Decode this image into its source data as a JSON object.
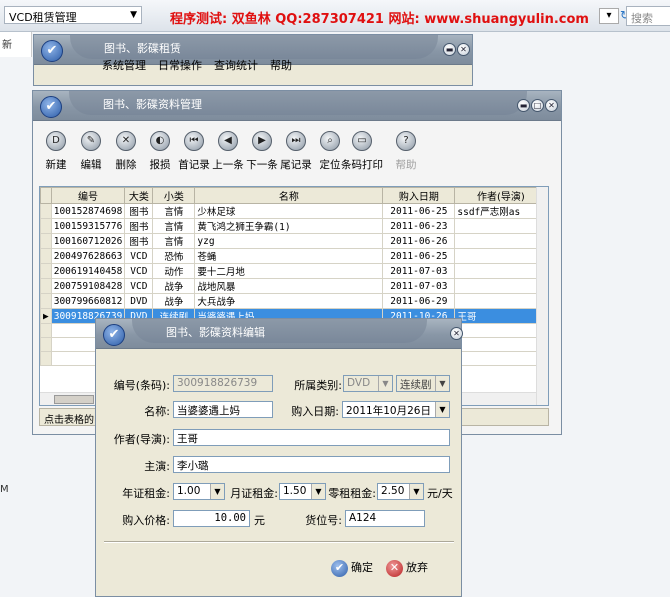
{
  "browser": {
    "tab_title": "VCD租赁管理",
    "banner": "程序测试: 双鱼林 QQ:287307421  网站: www.shuangyulin.com",
    "search_placeholder": "搜索",
    "side_tab": "新",
    "left_fragment": "M"
  },
  "rent_window": {
    "title": "图书、影碟租赁",
    "menu": [
      "系统管理",
      "日常操作",
      "查询统计",
      "帮助"
    ]
  },
  "manage_window": {
    "title": "图书、影碟资料管理",
    "toolbar": [
      {
        "label": "新建",
        "icon": "new-icon",
        "glyph": "D"
      },
      {
        "label": "编辑",
        "icon": "edit-icon",
        "glyph": "✎"
      },
      {
        "label": "删除",
        "icon": "delete-icon",
        "glyph": "✕"
      },
      {
        "label": "报损",
        "icon": "damage-icon",
        "glyph": "◐"
      },
      {
        "label": "首记录",
        "icon": "first-record-icon",
        "glyph": "⏮"
      },
      {
        "label": "上一条",
        "icon": "prev-record-icon",
        "glyph": "◀"
      },
      {
        "label": "下一条",
        "icon": "next-record-icon",
        "glyph": "▶"
      },
      {
        "label": "尾记录",
        "icon": "last-record-icon",
        "glyph": "⏭"
      },
      {
        "label": "定位",
        "icon": "locate-icon",
        "glyph": "⌕"
      },
      {
        "label": "条码打印",
        "icon": "barcode-print-icon",
        "glyph": "▭"
      },
      {
        "label": "帮助",
        "icon": "help-icon",
        "glyph": "?"
      }
    ],
    "columns": [
      "编号",
      "大类",
      "小类",
      "名称",
      "购入日期",
      "作者(导演)"
    ],
    "rows": [
      [
        "100152874698",
        "图书",
        "言情",
        "少林足球",
        "2011-06-25",
        "ssdf严志刚as"
      ],
      [
        "100159315776",
        "图书",
        "言情",
        "黄飞鸿之狮王争霸(1)",
        "2011-06-23",
        ""
      ],
      [
        "100160712026",
        "图书",
        "言情",
        "yzg",
        "2011-06-26",
        ""
      ],
      [
        "200497628663",
        "VCD",
        "恐怖",
        "苍蝇",
        "2011-06-25",
        ""
      ],
      [
        "200619140458",
        "VCD",
        "动作",
        "要十二月地",
        "2011-07-03",
        ""
      ],
      [
        "200759108428",
        "VCD",
        "战争",
        "战地风暴",
        "2011-07-03",
        ""
      ],
      [
        "300799660812",
        "DVD",
        "战争",
        "大兵战争",
        "2011-06-29",
        ""
      ],
      [
        "300918826739",
        "DVD",
        "连续剧",
        "当婆婆遇上妈",
        "2011-10-26",
        "王哥"
      ]
    ],
    "selected_row": 7,
    "status": "点击表格的"
  },
  "edit_dialog": {
    "title": "图书、影碟资料编辑",
    "barcode_label": "编号(条码):",
    "barcode_value": "300918826739",
    "category_label": "所属类别:",
    "category_main": "DVD",
    "category_sub": "连续剧",
    "name_label": "名称:",
    "name_value": "当婆婆遇上妈",
    "purchase_date_label": "购入日期:",
    "purchase_date_value": "2011年10月26日",
    "author_label": "作者(导演):",
    "author_value": "王哥",
    "actor_label": "主演:",
    "actor_value": "李小璐",
    "year_rent_label": "年证租金:",
    "year_rent_value": "1.00",
    "month_rent_label": "月证租金:",
    "month_rent_value": "1.50",
    "retail_rent_label": "零租租金:",
    "retail_rent_value": "2.50",
    "unit_per_day": "元/天",
    "price_label": "购入价格:",
    "price_value": "10.00",
    "price_unit": "元",
    "shelf_label": "货位号:",
    "shelf_value": "A124",
    "ok_label": "确定",
    "cancel_label": "放弃"
  }
}
